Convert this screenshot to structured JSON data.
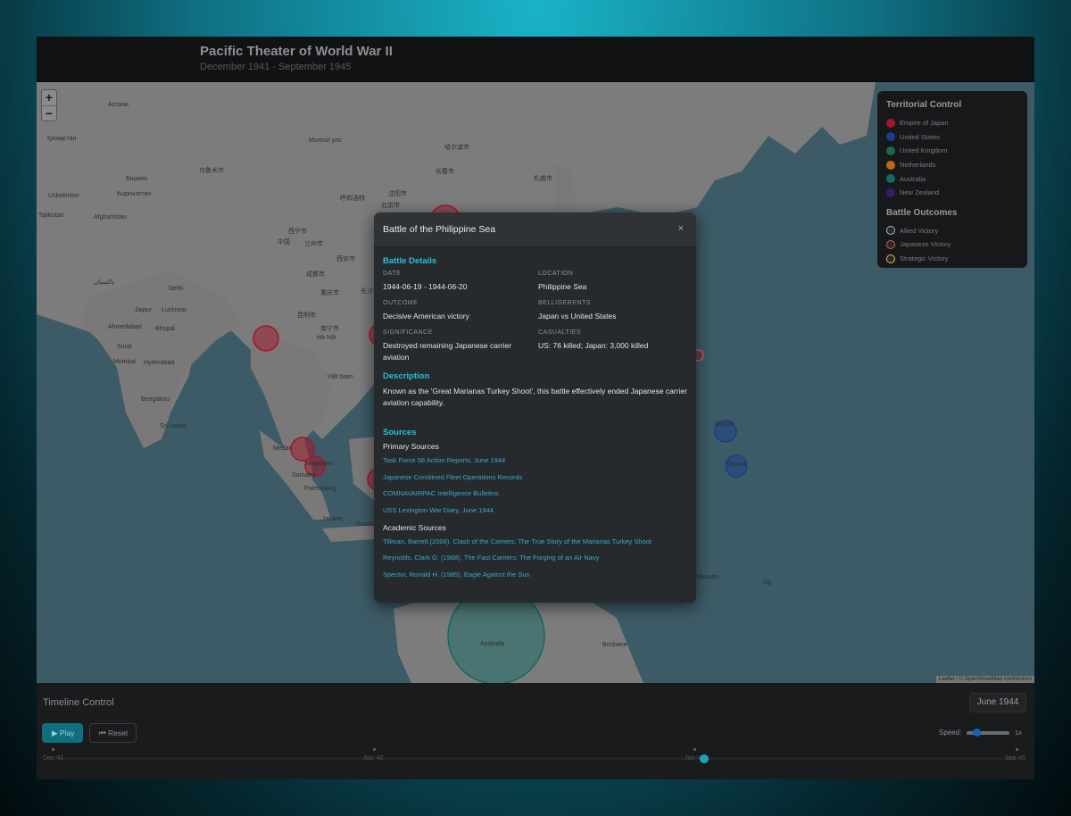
{
  "header": {
    "title": "Pacific Theater of World War II",
    "subtitle": "December 1941 - September 1945"
  },
  "map": {
    "zoom_in": "+",
    "zoom_out": "−",
    "attribution": "Leaflet | © OpenStreetMap contributors",
    "labels": [
      "Астана",
      "Қазақстан",
      "Монгол улс",
      "Бишкек",
      "Кыргызстан",
      "Uzbekiston",
      "Tajikistan",
      "Afghanistan",
      "پاکستان",
      "Delhi",
      "Jaipur",
      "Lucknow",
      "Ahmedabad",
      "Bhopal",
      "Surat",
      "Mumbai",
      "Hyderabad",
      "Bengaluru",
      "Sri Lanka",
      "Medan",
      "Singapore",
      "Palembang",
      "Jakarta",
      "Surabaya",
      "Sumatra",
      "Việt Nam",
      "Hà Nội",
      "中国",
      "西安市",
      "成都市",
      "重庆市",
      "昆明市",
      "南宁市",
      "长沙市",
      "北京市",
      "沈阳市",
      "长春市",
      "哈尔滨市",
      "札幌市",
      "乌鲁木齐",
      "兰州市",
      "西宁市",
      "呼和浩特",
      "Australia",
      "Brisbane",
      "Majuro",
      "Tarawa",
      "Vanuatu",
      "Viti"
    ]
  },
  "legend": {
    "territorial_title": "Territorial Control",
    "territories": [
      {
        "name": "Empire of Japan",
        "color": "#a3162c"
      },
      {
        "name": "United States",
        "color": "#1a3f86"
      },
      {
        "name": "United Kingdom",
        "color": "#1a6b43"
      },
      {
        "name": "Netherlands",
        "color": "#c4661b"
      },
      {
        "name": "Australia",
        "color": "#0e6b63"
      },
      {
        "name": "New Zealand",
        "color": "#3a1b6b"
      }
    ],
    "outcomes_title": "Battle Outcomes",
    "outcomes": [
      {
        "name": "Allied Victory",
        "color": "#9db6e0"
      },
      {
        "name": "Japanese Victory",
        "color": "#d05a6a"
      },
      {
        "name": "Strategic Victory",
        "color": "#d8be3e"
      }
    ]
  },
  "modal": {
    "title": "Battle of the Philippine Sea",
    "close": "×",
    "details_heading": "Battle Details",
    "fields": {
      "date_label": "DATE",
      "date": "1944-06-19 - 1944-06-20",
      "location_label": "LOCATION",
      "location": "Philippine Sea",
      "outcome_label": "OUTCOME",
      "outcome": "Decisive American victory",
      "belligerents_label": "BELLIGERENTS",
      "belligerents": "Japan vs United States",
      "significance_label": "SIGNIFICANCE",
      "significance": "Destroyed remaining Japanese carrier aviation",
      "casualties_label": "CASUALTIES",
      "casualties": "US: 76 killed; Japan: 3,000 killed"
    },
    "description_heading": "Description",
    "description": "Known as the 'Great Marianas Turkey Shoot', this battle effectively ended Japanese carrier aviation capability.",
    "sources_heading": "Sources",
    "primary_heading": "Primary Sources",
    "primary": [
      "Task Force 58 Action Reports, June 1944",
      "Japanese Combined Fleet Operations Records",
      "COMNAVAIRPAC Intelligence Bulletins",
      "USS Lexington War Diary, June 1944"
    ],
    "academic_heading": "Academic Sources",
    "academic": [
      "Tillman, Barrett (2006). Clash of the Carriers: The True Story of the Marianas Turkey Shoot",
      "Reynolds, Clark G. (1968). The Fast Carriers: The Forging of an Air Navy",
      "Spector, Ronald H. (1985). Eagle Against the Sun"
    ]
  },
  "timeline": {
    "title": "Timeline Control",
    "current_date": "June 1944",
    "play_label": "▶ Play",
    "reset_label": "⏮ Reset",
    "speed_label": "Speed:",
    "speed_value": "1x",
    "speed_level": 0.25,
    "ticks": [
      "Dec '41",
      "Jun '42",
      "Jun '44",
      "Sep '45"
    ],
    "progress": 0.675
  }
}
